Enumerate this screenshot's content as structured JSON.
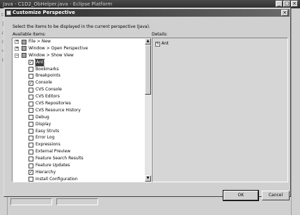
{
  "background_window": {
    "title": "Java - C1D2_ObHelper.java - Eclipse Platform",
    "controls": [
      "_",
      "□",
      "×"
    ]
  },
  "dialog": {
    "title": "Customize Perspective",
    "close": "×",
    "instructions": "Select the items to be displayed in the current perspective (Java).",
    "available_label": "Available Items:",
    "details_label": "Details:",
    "details_item": "Ant",
    "ok_label": "OK",
    "cancel_label": "Cancel",
    "scroll_up": "▲",
    "scroll_down": "▼"
  },
  "tree": [
    {
      "level": 0,
      "expand": "+",
      "state": "partial",
      "label": "File > New"
    },
    {
      "level": 0,
      "expand": "+",
      "state": "partial",
      "label": "Window > Open Perspective"
    },
    {
      "level": 0,
      "expand": "−",
      "state": "partial",
      "label": "Window > Show View"
    },
    {
      "level": 1,
      "state": "checked",
      "label": "Ant",
      "selected": true
    },
    {
      "level": 1,
      "state": "unchecked",
      "label": "Bookmarks"
    },
    {
      "level": 1,
      "state": "unchecked",
      "label": "Breakpoints"
    },
    {
      "level": 1,
      "state": "checked",
      "label": "Console"
    },
    {
      "level": 1,
      "state": "unchecked",
      "label": "CVS Console"
    },
    {
      "level": 1,
      "state": "unchecked",
      "label": "CVS Editors"
    },
    {
      "level": 1,
      "state": "unchecked",
      "label": "CVS Repositories"
    },
    {
      "level": 1,
      "state": "unchecked",
      "label": "CVS Resource History"
    },
    {
      "level": 1,
      "state": "unchecked",
      "label": "Debug"
    },
    {
      "level": 1,
      "state": "unchecked",
      "label": "Display"
    },
    {
      "level": 1,
      "state": "unchecked",
      "label": "Easy Struts"
    },
    {
      "level": 1,
      "state": "unchecked",
      "label": "Error Log"
    },
    {
      "level": 1,
      "state": "unchecked",
      "label": "Expressions"
    },
    {
      "level": 1,
      "state": "unchecked",
      "label": "External Preview"
    },
    {
      "level": 1,
      "state": "unchecked",
      "label": "Feature Search Results"
    },
    {
      "level": 1,
      "state": "unchecked",
      "label": "Feature Updates"
    },
    {
      "level": 1,
      "state": "checked",
      "label": "Hierarchy"
    },
    {
      "level": 1,
      "state": "unchecked",
      "label": "Install Configuration"
    }
  ]
}
